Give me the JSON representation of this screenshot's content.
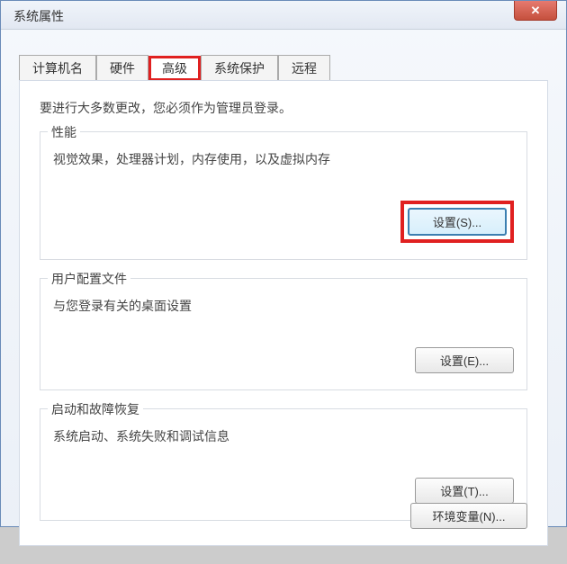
{
  "window": {
    "title": "系统属性"
  },
  "tabs": {
    "items": [
      {
        "label": "计算机名"
      },
      {
        "label": "硬件"
      },
      {
        "label": "高级"
      },
      {
        "label": "系统保护"
      },
      {
        "label": "远程"
      }
    ],
    "active_index": 2,
    "highlighted_index": 2
  },
  "panel": {
    "admin_notice": "要进行大多数更改，您必须作为管理员登录。",
    "groups": {
      "performance": {
        "title": "性能",
        "desc": "视觉效果，处理器计划，内存使用，以及虚拟内存",
        "button": "设置(S)...",
        "button_highlighted": true
      },
      "userprofile": {
        "title": "用户配置文件",
        "desc": "与您登录有关的桌面设置",
        "button": "设置(E)..."
      },
      "startup": {
        "title": "启动和故障恢复",
        "desc": "系统启动、系统失败和调试信息",
        "button": "设置(T)..."
      }
    },
    "env_button": "环境变量(N)..."
  }
}
